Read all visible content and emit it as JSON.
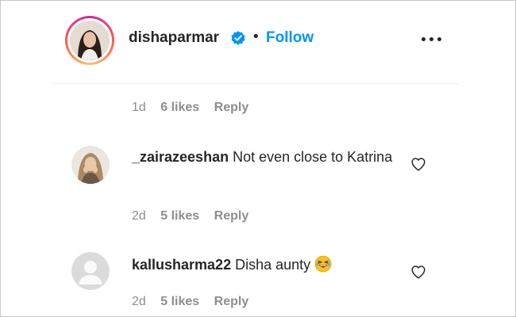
{
  "post": {
    "username": "dishaparmar",
    "separator": "•",
    "follow_label": "Follow",
    "more_icon": "more-horizontal-icon",
    "verified_color": "#0095f6"
  },
  "caption_meta": {
    "time": "1d",
    "likes": "6 likes",
    "reply": "Reply"
  },
  "comments": [
    {
      "username": "_zairazeeshan",
      "text": "Not even close to Katrina",
      "time": "2d",
      "likes": "5 likes",
      "reply": "Reply",
      "avatar": "profile-photo"
    },
    {
      "username": "kallusharma22",
      "text": "Disha aunty",
      "emoji": "😂",
      "time": "2d",
      "likes": "5 likes",
      "reply": "Reply",
      "avatar": "default-profile-placeholder"
    }
  ],
  "colors": {
    "primary_text": "#262626",
    "secondary_text": "#8e8e8e",
    "link_blue": "#0095f6"
  }
}
